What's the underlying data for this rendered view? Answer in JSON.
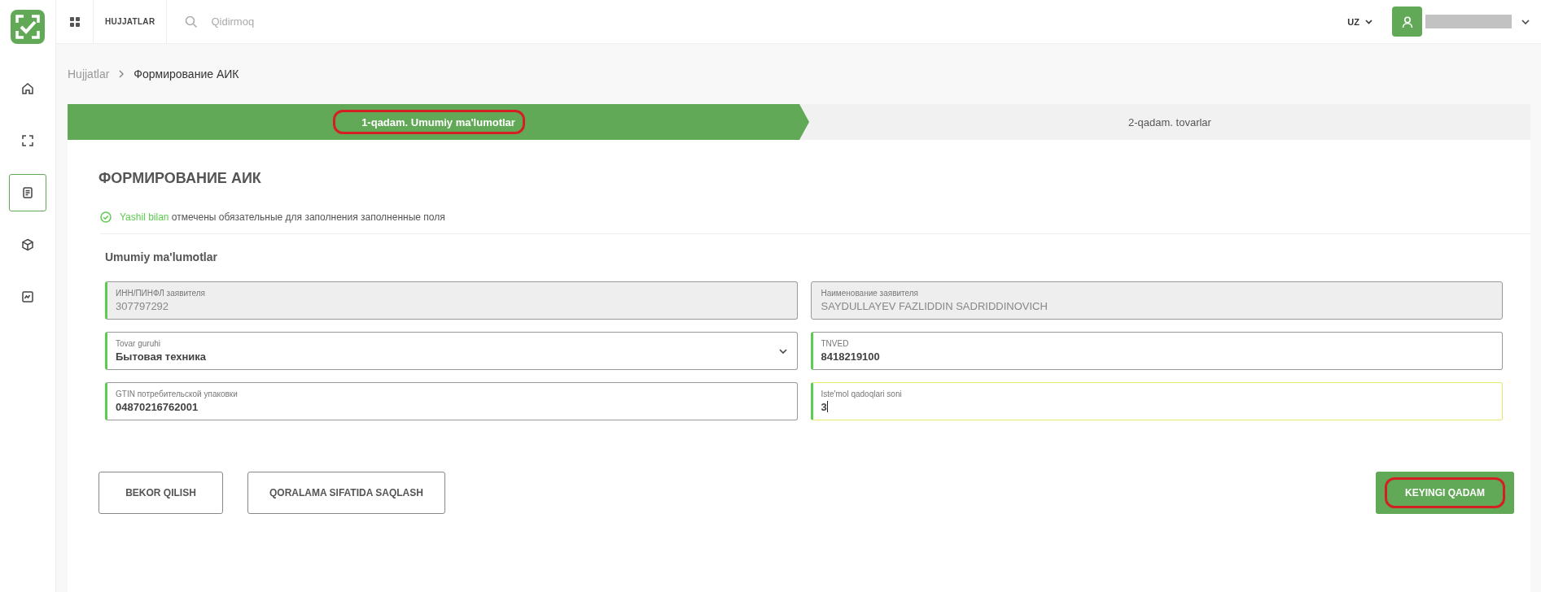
{
  "topbar": {
    "section": "HUJJATLAR",
    "search": {
      "placeholder": "Qidirmoq"
    },
    "language": "UZ"
  },
  "sidebar": {
    "items": [
      {
        "selected": false
      },
      {
        "selected": false
      },
      {
        "selected": true
      },
      {
        "selected": false
      },
      {
        "selected": false
      }
    ]
  },
  "breadcrumb": [
    "Hujjatlar",
    "Формирование АИК"
  ],
  "steps": [
    {
      "label": "1-qadam. Umumiy ma'lumotlar",
      "selected": true,
      "highlighted": true
    },
    {
      "label": "2-qadam. tovarlar",
      "selected": false,
      "highlighted": false
    }
  ],
  "title": "ФОРМИРОВАНИЕ АИК",
  "notice": {
    "highlight": "Yashil bilan",
    "text": "отмечены обязательные для заполнения заполненные поля"
  },
  "section": "Umumiy ma'lumotlar",
  "fields": [
    {
      "kind": "text",
      "label": "ИНН/ПИНФЛ заявителя",
      "value": "307797292",
      "disabled": true,
      "required": true,
      "focused": false
    },
    {
      "kind": "text",
      "label": "Наименование заявителя",
      "value": "SAYDULLAYEV FAZLIDDIN SADRIDDINOVICH",
      "disabled": true,
      "required": false,
      "focused": false
    },
    {
      "kind": "select",
      "label": "Tovar guruhi",
      "value": "Бытовая техника",
      "disabled": false,
      "required": true,
      "focused": false
    },
    {
      "kind": "text",
      "label": "TNVED",
      "value": "8418219100",
      "disabled": false,
      "required": true,
      "focused": false
    },
    {
      "kind": "text",
      "label": "GTIN потребительской упаковки",
      "value": "04870216762001",
      "disabled": false,
      "required": true,
      "focused": false
    },
    {
      "kind": "text",
      "label": "Iste'mol qadoqlari soni",
      "value": "3",
      "disabled": false,
      "required": true,
      "focused": true
    }
  ],
  "buttons": [
    {
      "label": "BEKOR QILISH",
      "kind": "outline",
      "highlighted": false
    },
    {
      "label": "QORALAMA SIFATIDA SAQLASH",
      "kind": "outline",
      "highlighted": false
    },
    {
      "label": "KEYINGI QADAM",
      "kind": "primary",
      "highlighted": true
    }
  ]
}
